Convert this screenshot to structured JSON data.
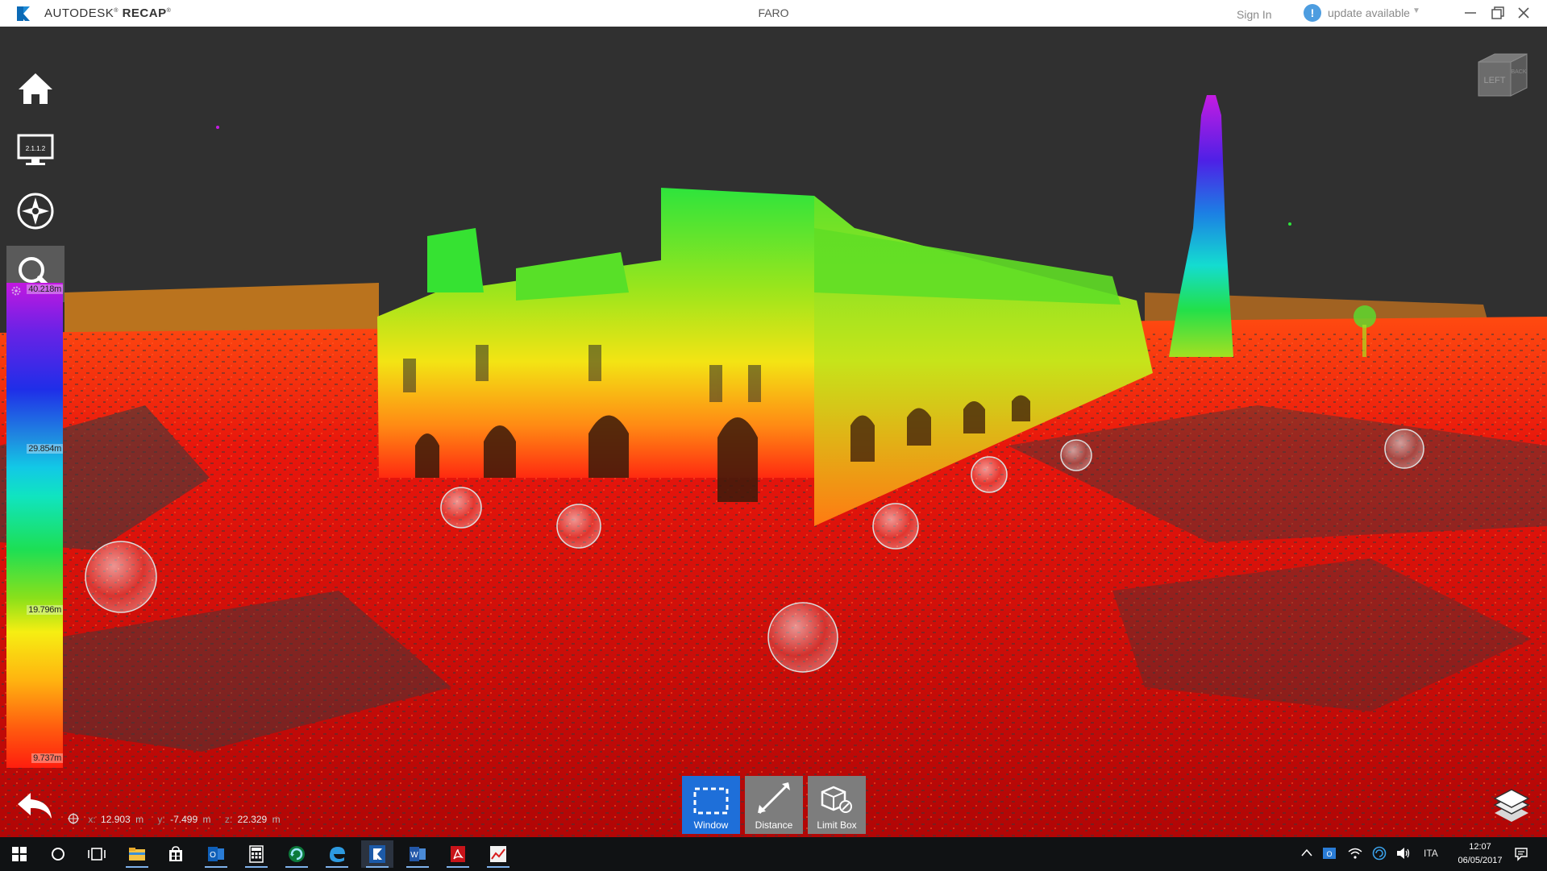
{
  "titlebar": {
    "brand_prefix": "AUTODESK",
    "brand_product": "RECAP",
    "document_title": "FARO",
    "sign_in": "Sign In",
    "update_icon": "!",
    "update_text": "update available",
    "window_controls": [
      "minimize-icon",
      "restore-icon",
      "close-icon"
    ]
  },
  "left_toolbar": {
    "items": [
      {
        "name": "home",
        "icon": "home-icon"
      },
      {
        "name": "display",
        "icon": "monitor-icon",
        "badge": "2.1.1.2"
      },
      {
        "name": "navigation",
        "icon": "compass-icon"
      },
      {
        "name": "search",
        "icon": "search-icon",
        "active": true
      }
    ]
  },
  "color_scale": {
    "labels": [
      "40.218m",
      "29.854m",
      "19.796m",
      "9.737m"
    ],
    "max": 40.218,
    "min": 9.737
  },
  "coordinates": {
    "x_label": "x:",
    "x_value": "12.903",
    "x_unit": "m",
    "y_label": "y:",
    "y_value": "-7.499",
    "y_unit": "m",
    "z_label": "z:",
    "z_value": "22.329",
    "z_unit": "m"
  },
  "bottom_tools": [
    {
      "label": "Window",
      "icon": "window-select-icon",
      "selected": true
    },
    {
      "label": "Distance",
      "icon": "distance-icon",
      "selected": false
    },
    {
      "label": "Limit Box",
      "icon": "limit-box-icon",
      "selected": false
    }
  ],
  "viewcube": {
    "faces": [
      "LEFT",
      "BACK"
    ]
  },
  "colors": {
    "viewport_bg": "#303030",
    "selected_tool": "#1e6fd9",
    "update_badge": "#4d9de0"
  },
  "taskbar": {
    "apps": [
      "start-icon",
      "search-circle-icon",
      "task-view-icon",
      "file-explorer-icon",
      "store-icon",
      "outlook-icon",
      "calculator-icon",
      "browser-refresh-icon",
      "edge-icon",
      "recap-icon",
      "word-icon",
      "acrobat-icon",
      "photo-app-icon"
    ],
    "language": "ITA",
    "time": "12:07",
    "date": "06/05/2017"
  }
}
